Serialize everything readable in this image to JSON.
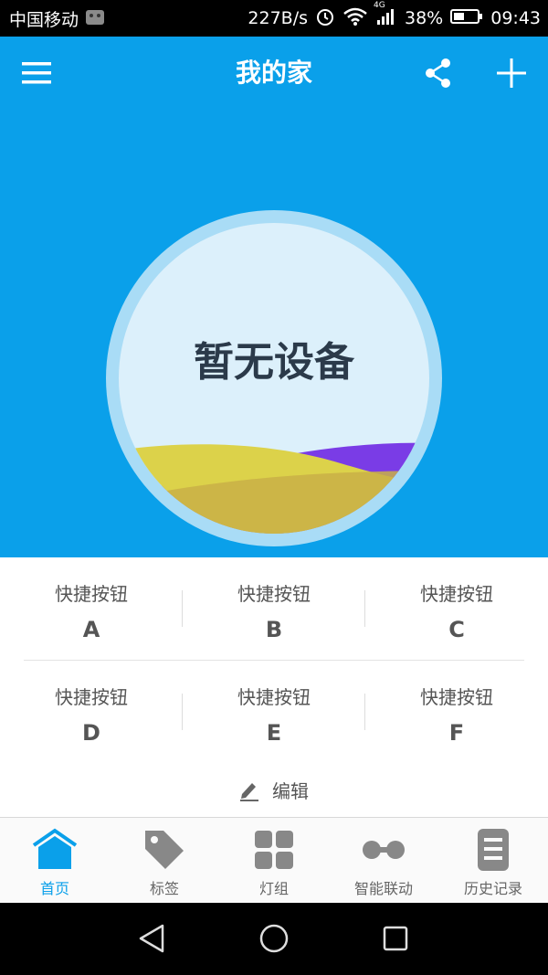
{
  "status_bar": {
    "carrier": "中国移动",
    "speed": "227B/s",
    "network": "4G",
    "battery": "38%",
    "time": "09:43"
  },
  "header": {
    "title": "我的家",
    "menu_icon": "menu-icon",
    "share_icon": "share-icon",
    "add_icon": "plus-icon",
    "background_color": "#0aa0ea"
  },
  "home_circle": {
    "empty_text": "暂无设备"
  },
  "quick_buttons": [
    {
      "label": "快捷按钮",
      "letter": "A"
    },
    {
      "label": "快捷按钮",
      "letter": "B"
    },
    {
      "label": "快捷按钮",
      "letter": "C"
    },
    {
      "label": "快捷按钮",
      "letter": "D"
    },
    {
      "label": "快捷按钮",
      "letter": "E"
    },
    {
      "label": "快捷按钮",
      "letter": "F"
    }
  ],
  "edit": {
    "label": "编辑",
    "icon": "pencil-icon"
  },
  "tabs": [
    {
      "label": "首页",
      "icon": "home-icon",
      "active": true
    },
    {
      "label": "标签",
      "icon": "tag-icon",
      "active": false
    },
    {
      "label": "灯组",
      "icon": "grid-icon",
      "active": false
    },
    {
      "label": "智能联动",
      "icon": "link-icon",
      "active": false
    },
    {
      "label": "历史记录",
      "icon": "history-icon",
      "active": false
    }
  ],
  "nav_bar": {
    "back_icon": "back-triangle-icon",
    "home_icon": "home-circle-icon",
    "recents_icon": "recents-square-icon"
  }
}
